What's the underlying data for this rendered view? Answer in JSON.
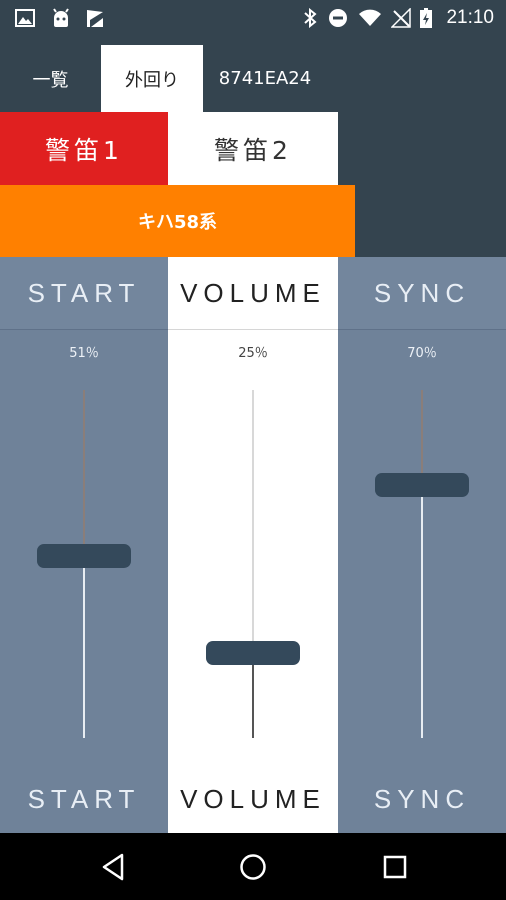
{
  "status_bar": {
    "time": "21:10",
    "left_icons": [
      "image-icon",
      "android-icon",
      "flag-icon"
    ],
    "right_icons": [
      "bluetooth-icon",
      "do-not-disturb-icon",
      "wifi-icon",
      "no-signal-icon",
      "battery-charging-icon"
    ]
  },
  "tabs": [
    {
      "label": "一覧",
      "active": false
    },
    {
      "label": "外回り",
      "active": true
    },
    {
      "label": "8741EA24",
      "active": false
    }
  ],
  "whistle_buttons": {
    "whistle1": "警笛1",
    "whistle2": "警笛2",
    "whistle1_color": "#e02020"
  },
  "series_button": {
    "label": "キハ58系",
    "color": "#ff8000"
  },
  "sliders": [
    {
      "label": "START",
      "percent_text": "51％",
      "value": 0.51
    },
    {
      "label": "VOLUME",
      "percent_text": "25％",
      "value": 0.25
    },
    {
      "label": "SYNC",
      "percent_text": "70％",
      "value": 0.7
    }
  ],
  "nav": [
    "back-icon",
    "home-icon",
    "recents-icon"
  ]
}
